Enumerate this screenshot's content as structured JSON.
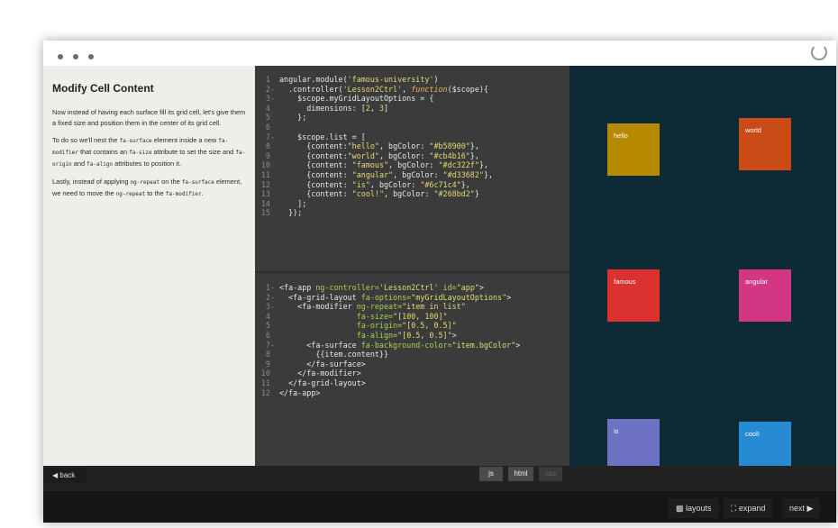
{
  "lesson": {
    "title": "Modify Cell Content",
    "p1": "Now instead of having each surface fill its grid cell, let's give them a fixed size and position them in the center of its grid cell.",
    "p2": {
      "t1": "To do so we'll nest the ",
      "c1": "fa-surface",
      "t2": " element inside a new ",
      "c2": "fa-modifier",
      "t3": " that contains an ",
      "c3": "fa-size",
      "t4": " attribute to set the size and ",
      "c4": "fa-origin",
      "t5": " and ",
      "c5": "fa-align",
      "t6": " attributes to position it."
    },
    "p3": {
      "t1": "Lastly, instead of applying ",
      "c1": "ng-repeat",
      "t2": " on the ",
      "c2": "fa-surface",
      "t3": " element, we need to move the ",
      "c3": "ng-repeat",
      "t4": " to the ",
      "c4": "fa-modifier",
      "t5": "."
    }
  },
  "js_code": [
    {
      "n": "1",
      "fold": false,
      "parts": [
        [
          "t",
          "angular.module("
        ],
        [
          "s",
          "'famous-university'"
        ],
        [
          "t",
          ")"
        ]
      ]
    },
    {
      "n": "2",
      "fold": true,
      "parts": [
        [
          "t",
          "  .controller("
        ],
        [
          "s",
          "'Lesson2Ctrl'"
        ],
        [
          "t",
          ", "
        ],
        [
          "f",
          "function"
        ],
        [
          "t",
          "($scope){"
        ]
      ]
    },
    {
      "n": "3",
      "fold": true,
      "parts": [
        [
          "t",
          "    $scope.myGridLayoutOptions = {"
        ]
      ]
    },
    {
      "n": "4",
      "fold": false,
      "parts": [
        [
          "t",
          "      dimensions: ["
        ],
        [
          "s",
          "2"
        ],
        [
          "t",
          ", "
        ],
        [
          "s",
          "3"
        ],
        [
          "t",
          "]"
        ]
      ]
    },
    {
      "n": "5",
      "fold": false,
      "parts": [
        [
          "t",
          "    };"
        ]
      ]
    },
    {
      "n": "6",
      "fold": false,
      "parts": [
        [
          "t",
          ""
        ]
      ]
    },
    {
      "n": "7",
      "fold": true,
      "parts": [
        [
          "t",
          "    $scope.list = ["
        ]
      ]
    },
    {
      "n": "8",
      "fold": false,
      "parts": [
        [
          "t",
          "      {content:"
        ],
        [
          "s",
          "\"hello\""
        ],
        [
          "t",
          ", bgColor: "
        ],
        [
          "s",
          "\"#b58900\""
        ],
        [
          "t",
          "},"
        ]
      ]
    },
    {
      "n": "9",
      "fold": false,
      "parts": [
        [
          "t",
          "      {content:"
        ],
        [
          "s",
          "\"world\""
        ],
        [
          "t",
          ", bgColor: "
        ],
        [
          "s",
          "\"#cb4b16\""
        ],
        [
          "t",
          "},"
        ]
      ]
    },
    {
      "n": "10",
      "fold": false,
      "parts": [
        [
          "t",
          "      {content: "
        ],
        [
          "s",
          "\"famous\""
        ],
        [
          "t",
          ", bgColor: "
        ],
        [
          "s",
          "\"#dc322f\""
        ],
        [
          "t",
          "},"
        ]
      ]
    },
    {
      "n": "11",
      "fold": false,
      "parts": [
        [
          "t",
          "      {content: "
        ],
        [
          "s",
          "\"angular\""
        ],
        [
          "t",
          ", bgColor: "
        ],
        [
          "s",
          "\"#d33682\""
        ],
        [
          "t",
          "},"
        ]
      ]
    },
    {
      "n": "12",
      "fold": false,
      "parts": [
        [
          "t",
          "      {content: "
        ],
        [
          "s",
          "\"is\""
        ],
        [
          "t",
          ", bgColor: "
        ],
        [
          "s",
          "\"#6c71c4\""
        ],
        [
          "t",
          "},"
        ]
      ]
    },
    {
      "n": "13",
      "fold": false,
      "parts": [
        [
          "t",
          "      {content: "
        ],
        [
          "s",
          "\"cool!\""
        ],
        [
          "t",
          ", bgColor: "
        ],
        [
          "s",
          "\"#268bd2\""
        ],
        [
          "t",
          "}"
        ]
      ]
    },
    {
      "n": "14",
      "fold": false,
      "parts": [
        [
          "t",
          "    ];"
        ]
      ]
    },
    {
      "n": "15",
      "fold": false,
      "parts": [
        [
          "t",
          "  });"
        ]
      ]
    }
  ],
  "html_code": [
    {
      "n": "1",
      "fold": true,
      "parts": [
        [
          "t",
          "<fa-app "
        ],
        [
          "a",
          "ng-controller="
        ],
        [
          "s",
          "'Lesson2Ctrl'"
        ],
        [
          "t",
          " "
        ],
        [
          "a",
          "id="
        ],
        [
          "s",
          "\"app\""
        ],
        [
          "t",
          ">"
        ]
      ]
    },
    {
      "n": "2",
      "fold": true,
      "parts": [
        [
          "t",
          "  <fa-grid-layout "
        ],
        [
          "a",
          "fa-options="
        ],
        [
          "s",
          "\"myGridLayoutOptions\""
        ],
        [
          "t",
          ">"
        ]
      ]
    },
    {
      "n": "3",
      "fold": true,
      "parts": [
        [
          "t",
          "    <fa-modifier "
        ],
        [
          "a",
          "ng-repeat="
        ],
        [
          "s",
          "\"item in list\""
        ]
      ]
    },
    {
      "n": "4",
      "fold": false,
      "parts": [
        [
          "t",
          "                 "
        ],
        [
          "a",
          "fa-size="
        ],
        [
          "s",
          "\"[100, 100]\""
        ]
      ]
    },
    {
      "n": "5",
      "fold": false,
      "parts": [
        [
          "t",
          "                 "
        ],
        [
          "a",
          "fa-origin="
        ],
        [
          "s",
          "\"[0.5, 0.5]\""
        ]
      ]
    },
    {
      "n": "6",
      "fold": false,
      "parts": [
        [
          "t",
          "                 "
        ],
        [
          "a",
          "fa-align="
        ],
        [
          "s",
          "\"[0.5, 0.5]\""
        ],
        [
          "t",
          ">"
        ]
      ]
    },
    {
      "n": "7",
      "fold": true,
      "parts": [
        [
          "t",
          "      <fa-surface "
        ],
        [
          "a",
          "fa-background-color="
        ],
        [
          "s",
          "\"item.bgColor\""
        ],
        [
          "t",
          ">"
        ]
      ]
    },
    {
      "n": "8",
      "fold": false,
      "parts": [
        [
          "t",
          "        {{item.content}}"
        ]
      ]
    },
    {
      "n": "9",
      "fold": false,
      "parts": [
        [
          "t",
          "      </fa-surface>"
        ]
      ]
    },
    {
      "n": "10",
      "fold": false,
      "parts": [
        [
          "t",
          "    </fa-modifier>"
        ]
      ]
    },
    {
      "n": "11",
      "fold": false,
      "parts": [
        [
          "t",
          "  </fa-grid-layout>"
        ]
      ]
    },
    {
      "n": "12",
      "fold": false,
      "parts": [
        [
          "t",
          "</fa-app>"
        ]
      ]
    }
  ],
  "preview_tiles": [
    {
      "label": "hello",
      "color": "#b58900"
    },
    {
      "label": "world",
      "color": "#cb4b16"
    },
    {
      "label": "famous",
      "color": "#dc322f"
    },
    {
      "label": "angular",
      "color": "#d33682"
    },
    {
      "label": "is",
      "color": "#6c71c4"
    },
    {
      "label": "cool!",
      "color": "#268bd2"
    }
  ],
  "editor_tabs": {
    "js": "js",
    "html": "html",
    "css": "css"
  },
  "nav": {
    "back": "back",
    "layouts": "layouts",
    "expand": "expand",
    "next": "next"
  }
}
